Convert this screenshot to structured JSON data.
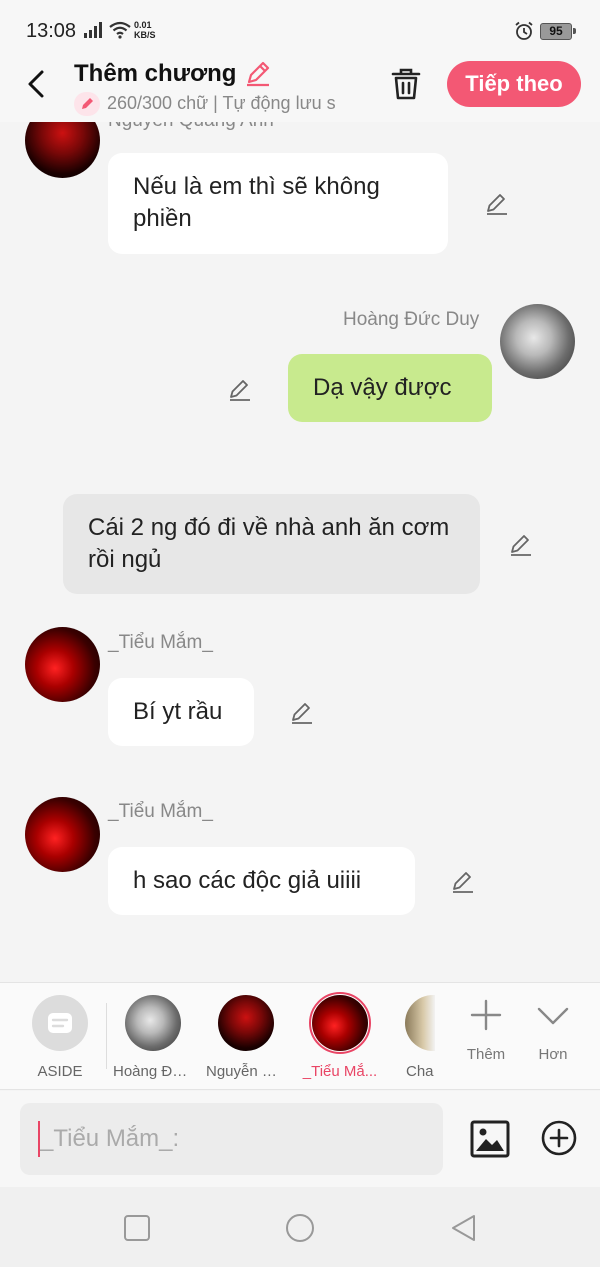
{
  "status_bar": {
    "time": "13:08",
    "net_speed_value": "0.01",
    "net_speed_unit": "KB/S",
    "battery": "95"
  },
  "header": {
    "title": "Thêm chương",
    "subtitle": "260/300 chữ | Tự động lưu s",
    "next_label": "Tiếp theo"
  },
  "messages": [
    {
      "type": "left",
      "name": "Nguyễn Quang Anh",
      "text": "Nếu là em thì sẽ không phiền"
    },
    {
      "type": "right",
      "name": "Hoàng Đức Duy",
      "text": "Dạ vậy được"
    },
    {
      "type": "aside",
      "text": "Cái 2 ng đó đi về nhà anh ăn cơm rồi ngủ"
    },
    {
      "type": "left",
      "name": "_Tiểu Mắm_",
      "text": "Bí yt rầu"
    },
    {
      "type": "left",
      "name": "_Tiểu Mắm_",
      "text": "h sao các độc giả uiiii"
    }
  ],
  "characters": [
    {
      "label": "ASIDE"
    },
    {
      "label": "Hoàng Đứ..."
    },
    {
      "label": "Nguyễn Q..."
    },
    {
      "label": "_Tiểu Mắ..."
    },
    {
      "label": "Cha"
    }
  ],
  "tools": {
    "add_label": "Thêm",
    "more_label": "Hơn"
  },
  "input": {
    "placeholder": "_Tiểu Mắm_:",
    "value": ""
  },
  "colors": {
    "accent": "#f35874",
    "bubble_right": "#c8ea8e",
    "bubble_aside": "#e7e7e7",
    "bubble_left": "#ffffff"
  }
}
